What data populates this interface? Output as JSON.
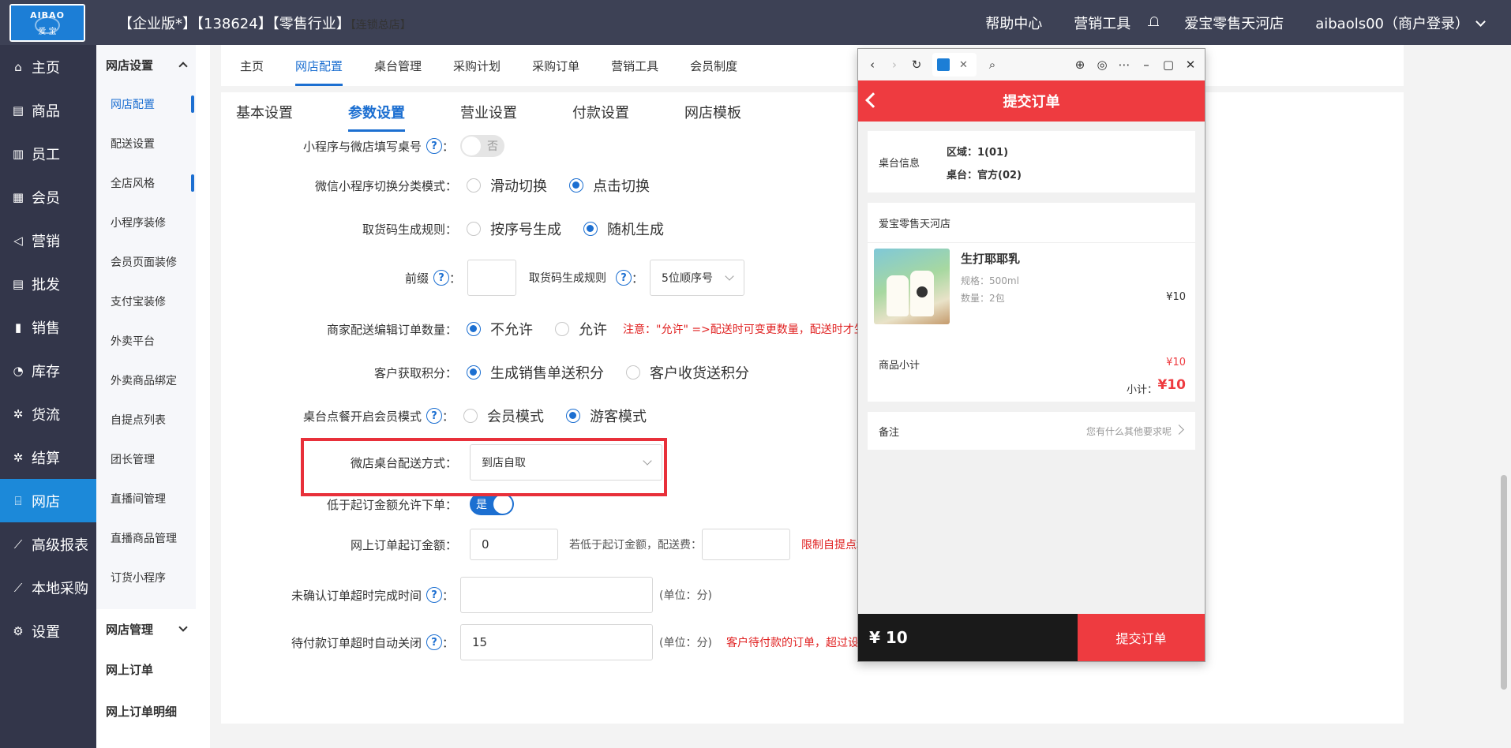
{
  "topbar": {
    "logo_text": "AIBAO",
    "logo_sub": "爱 宝",
    "title_main": "【企业版*】【138624】【零售行业】",
    "title_small": "【连锁总店】",
    "help": "帮助中心",
    "marketing": "营销工具",
    "store": "爱宝零售天河店",
    "user": "aibaols00（商户登录）"
  },
  "sidebar": [
    {
      "label": "主页",
      "icon": "home-icon",
      "glyph": "⌂"
    },
    {
      "label": "商品",
      "icon": "goods-icon",
      "glyph": "▤"
    },
    {
      "label": "员工",
      "icon": "staff-icon",
      "glyph": "▥"
    },
    {
      "label": "会员",
      "icon": "member-icon",
      "glyph": "▦"
    },
    {
      "label": "营销",
      "icon": "megaphone-icon",
      "glyph": "◁"
    },
    {
      "label": "批发",
      "icon": "wholesale-icon",
      "glyph": "▤"
    },
    {
      "label": "销售",
      "icon": "bar-chart-icon",
      "glyph": "▮"
    },
    {
      "label": "库存",
      "icon": "pie-icon",
      "glyph": "◔"
    },
    {
      "label": "货流",
      "icon": "flow-icon",
      "glyph": "✲"
    },
    {
      "label": "结算",
      "icon": "settle-icon",
      "glyph": "✲"
    },
    {
      "label": "网店",
      "icon": "gift-icon",
      "glyph": "⌸"
    },
    {
      "label": "高级报表",
      "icon": "line-chart-icon",
      "glyph": "⟋"
    },
    {
      "label": "本地采购",
      "icon": "trend-icon",
      "glyph": "⟋"
    },
    {
      "label": "设置",
      "icon": "gear-icon",
      "glyph": "⚙"
    }
  ],
  "subnav": {
    "group1": "网店设置",
    "items": [
      "网店配置",
      "配送设置",
      "全店风格",
      "小程序装修",
      "会员页面装修",
      "支付宝装修",
      "外卖平台",
      "外卖商品绑定",
      "自提点列表",
      "团长管理",
      "直播间管理",
      "直播商品管理",
      "订货小程序"
    ],
    "group2": "网店管理",
    "group3": "网上订单",
    "group4": "网上订单明细"
  },
  "tabs": [
    "主页",
    "网店配置",
    "桌台管理",
    "采购计划",
    "采购订单",
    "营销工具",
    "会员制度"
  ],
  "subtabs": [
    "基本设置",
    "参数设置",
    "营业设置",
    "付款设置",
    "网店模板"
  ],
  "form": {
    "table_no_label": "小程序与微店填写桌号",
    "table_no_toggle": "否",
    "category_mode_label": "微信小程序切换分类模式：",
    "category_opt1": "滑动切换",
    "category_opt2": "点击切换",
    "pickup_rule_label": "取货码生成规则：",
    "pickup_opt1": "按序号生成",
    "pickup_opt2": "随机生成",
    "prefix_label": "前缀",
    "prefix_rule_label": "取货码生成规则",
    "prefix_rule_value": "5位顺序号",
    "merchant_edit_label": "商家配送编辑订单数量：",
    "merchant_opt1": "不允许",
    "merchant_opt2": "允许",
    "merchant_note": "注意：\"允许\" =>配送时可变更数量，配送时才生成",
    "points_label": "客户获取积分：",
    "points_opt1": "生成销售单送积分",
    "points_opt2": "客户收货送积分",
    "member_mode_label": "桌台点餐开启会员模式",
    "member_opt1": "会员模式",
    "member_opt2": "游客模式",
    "delivery_label": "微店桌台配送方式：",
    "delivery_value": "到店自取",
    "below_min_label": "低于起订金额允许下单：",
    "below_min_toggle": "是",
    "min_amount_label": "网上订单起订金额：",
    "min_amount_value": "0",
    "fee_label": "若低于起订金额，配送费：",
    "fee_note": "限制自提点和自",
    "unconfirmed_label": "未确认订单超时完成时间",
    "unit1": "(单位：分)",
    "unpaid_label": "待付款订单超时自动关闭",
    "unpaid_value": "15",
    "unit2": "(单位：分)",
    "unpaid_note": "客户待付款的订单，超过设置的时间自动关闭订单"
  },
  "popup": {
    "title": "提交订单",
    "table_info_label": "桌台信息",
    "area": "区域：1(01)",
    "table": "桌台：官方(02)",
    "store_name": "爱宝零售天河店",
    "product_name": "生打耶耶乳",
    "spec": "规格：500ml",
    "qty": "数量：2包",
    "price": "¥10",
    "subtotal_label": "商品小计",
    "subtotal_value": "¥10",
    "total_label": "小计：",
    "total_value": "¥10",
    "remark_label": "备注",
    "remark_placeholder": "您有什么其他要求呢",
    "footer_total": "¥ 10",
    "submit": "提交订单"
  },
  "colors": {
    "accent": "#1c6fd1",
    "topbar": "#3d4155",
    "sidebar": "#33364a",
    "active_nav": "#1c89d9",
    "red": "#ee3b40"
  }
}
